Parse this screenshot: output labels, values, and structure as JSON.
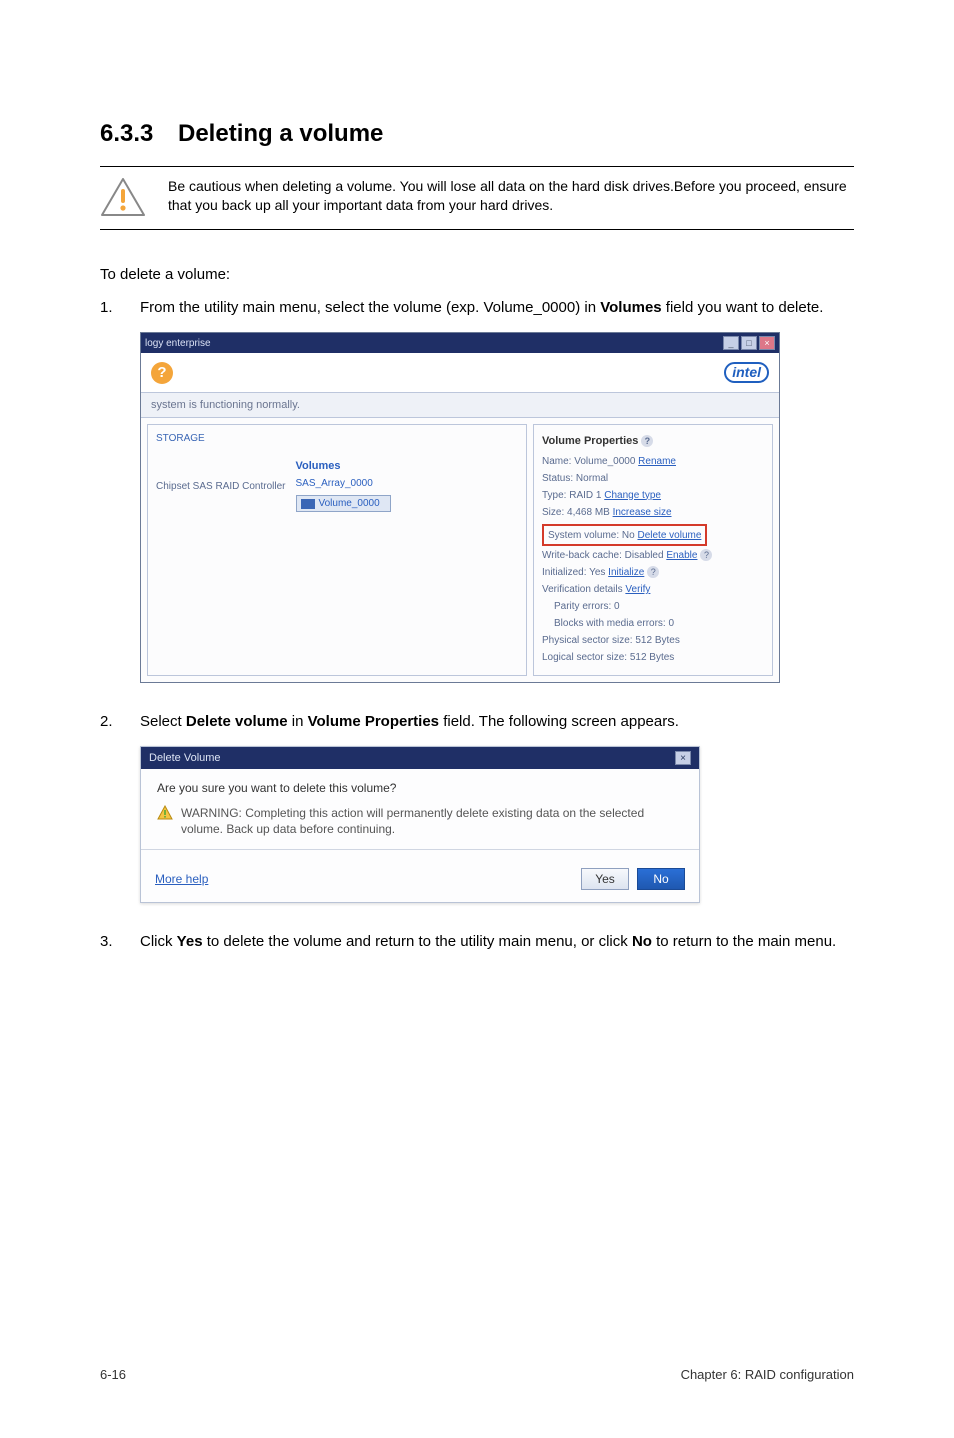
{
  "heading": {
    "number": "6.3.3",
    "title": "Deleting a volume"
  },
  "callout": {
    "text": "Be cautious when deleting a volume. You will lose all data on the hard disk drives.Before you proceed, ensure that you back up all your important data from your hard drives."
  },
  "intro": "To delete a volume:",
  "steps": {
    "s1": {
      "num": "1.",
      "before": "From the utility main menu, select the volume (exp. Volume_0000) in ",
      "bold": "Volumes",
      "after": " field you want to delete."
    },
    "s2": {
      "num": "2.",
      "before": "Select ",
      "b1": "Delete volume",
      "mid": " in ",
      "b2": "Volume Properties",
      "after": " field. The following screen appears."
    },
    "s3": {
      "num": "3.",
      "before": "Click ",
      "b1": "Yes",
      "mid": " to delete the volume and return to the utility main menu, or click ",
      "b2": "No",
      "after": " to return to the main menu."
    }
  },
  "shot1": {
    "titlebar": "logy enterprise",
    "win": {
      "min": "_",
      "max": "□",
      "close": "×"
    },
    "intel": "intel",
    "status": "system is functioning normally.",
    "left": {
      "tab": "STORAGE",
      "controller": "Chipset SAS RAID Controller",
      "array": "SAS_Array_0000",
      "volumes_label": "Volumes",
      "volume_chip": "Volume_0000"
    },
    "right": {
      "title": "Volume Properties",
      "l1a": "Name: Volume_0000 ",
      "l1b": "Rename",
      "l2": "Status: Normal",
      "l3a": "Type: RAID 1 ",
      "l3b": "Change type",
      "l4a": "Size: 4,468 MB ",
      "l4b": "Increase size",
      "red_a": "System volume: No ",
      "red_b": "Delete volume",
      "l6a": "Write-back cache: Disabled ",
      "l6b": "Enable",
      "l7": "Initialized: Yes ",
      "l7b": "Initialize",
      "l8a": "Verification details ",
      "l8b": "Verify",
      "l9": "Parity errors: 0",
      "l10": "Blocks with media errors: 0",
      "l11": "Physical sector size: 512 Bytes",
      "l12": "Logical sector size: 512 Bytes"
    }
  },
  "shot2": {
    "title": "Delete Volume",
    "close": "×",
    "question": "Are you sure you want to delete this volume?",
    "warning": "WARNING: Completing this action will permanently delete existing data on the selected volume. Back up data before continuing.",
    "more": "More help",
    "yes": "Yes",
    "no": "No"
  },
  "footer": {
    "left": "6-16",
    "right": "Chapter 6: RAID configuration"
  }
}
